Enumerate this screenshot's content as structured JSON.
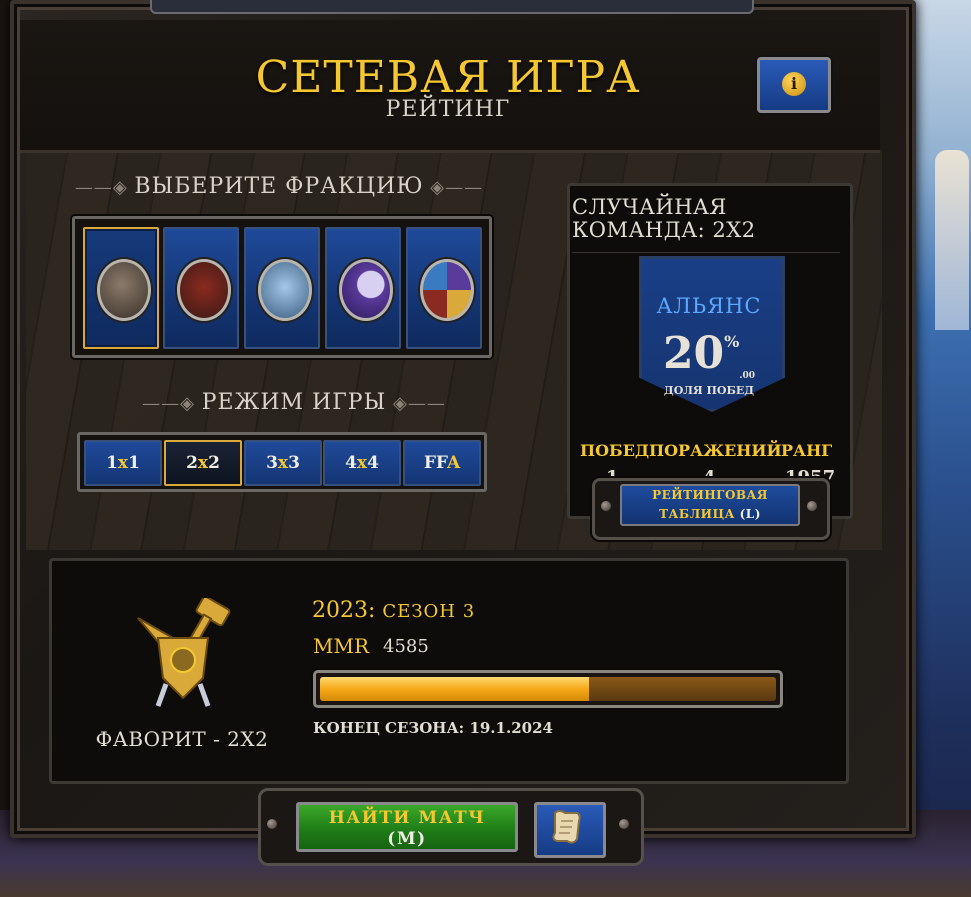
{
  "header": {
    "title": "СЕТЕВАЯ ИГРА",
    "subtitle": "РЕЙТИНГ",
    "info_icon": "info-icon"
  },
  "faction_section": {
    "title": "ВЫБЕРИТЕ ФРАКЦИЮ",
    "factions": [
      {
        "name": "human-emblem-icon",
        "selected": true
      },
      {
        "name": "orc-emblem-icon",
        "selected": false
      },
      {
        "name": "undead-emblem-icon",
        "selected": false
      },
      {
        "name": "night-elf-emblem-icon",
        "selected": false
      },
      {
        "name": "random-emblem-icon",
        "selected": false
      }
    ]
  },
  "mode_section": {
    "title": "РЕЖИМ ИГРЫ",
    "modes": [
      {
        "a": "1",
        "x": "x",
        "b": "1",
        "selected": false
      },
      {
        "a": "2",
        "x": "x",
        "b": "2",
        "selected": true
      },
      {
        "a": "3",
        "x": "x",
        "b": "3",
        "selected": false
      },
      {
        "a": "4",
        "x": "x",
        "b": "4",
        "selected": false
      },
      {
        "a": "F",
        "x": "F",
        "b": "A",
        "selected": false
      }
    ]
  },
  "random_team": {
    "title_line1": "СЛУЧАЙНАЯ",
    "title_line2": "КОМАНДА: 2X2",
    "faction": "АЛЬЯНС",
    "win_pct": "20",
    "pct_sign": "%",
    "pct_decimals": ".00",
    "win_label": "ДОЛЯ ПОБЕД",
    "stats": {
      "wins_label": "ПОБЕД",
      "losses_label": "ПОРАЖЕНИЙ",
      "rank_label": "РАНГ",
      "wins": "1",
      "losses": "4",
      "rank": "1957"
    },
    "leaderboard_line1": "РЕЙТИНГОВАЯ",
    "leaderboard_line2": "ТАБЛИЦА",
    "leaderboard_key": "(L)"
  },
  "season": {
    "favorite_label": "ФАВОРИТ - 2X2",
    "year": "2023:",
    "season_name": "СЕЗОН 3",
    "mmr_label": "MMR",
    "mmr_value": "4585",
    "progress": 0.59,
    "end_label": "КОНЕЦ СЕЗОНА: 19.1.2024"
  },
  "actions": {
    "find_match": "НАЙТИ МАТЧ",
    "find_match_key": "(M)",
    "scroll_icon": "scroll-icon"
  },
  "colors": {
    "gold": "#f5c832",
    "blue_button": "#1f4a9a",
    "green_button": "#1e7a16",
    "alliance_blue": "#5aa8ff"
  }
}
